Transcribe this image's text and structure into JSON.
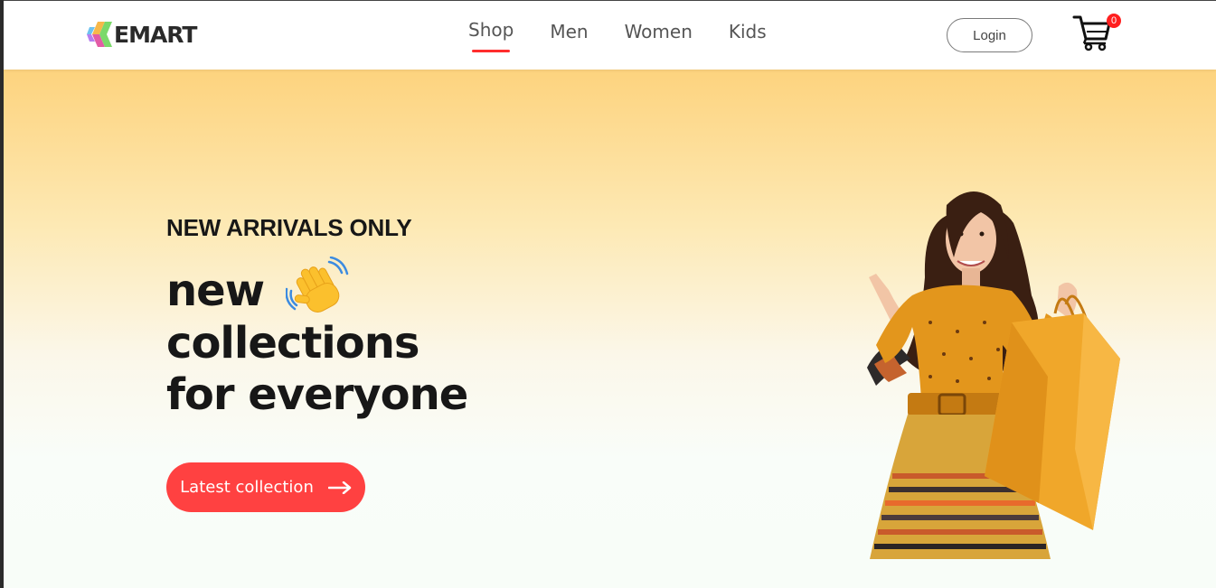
{
  "brand": {
    "name": "EMART",
    "logo_icon": "hexagon-logo-icon"
  },
  "nav": {
    "items": [
      {
        "label": "Shop",
        "active": true
      },
      {
        "label": "Men",
        "active": false
      },
      {
        "label": "Women",
        "active": false
      },
      {
        "label": "Kids",
        "active": false
      }
    ],
    "login_label": "Login",
    "cart": {
      "icon": "cart-icon",
      "count": "0"
    }
  },
  "hero": {
    "tagline": "NEW ARRIVALS ONLY",
    "title_lines": [
      "new",
      "collections",
      "for everyone"
    ],
    "title_emoji": "waving-hand-icon",
    "cta_label": "Latest collection",
    "cta_icon": "arrow-right-icon",
    "image": "woman-with-shopping-bag"
  },
  "colors": {
    "accent": "#ff4141",
    "underline": "#ff2d2d",
    "hero_top": "#fdd37e",
    "hero_bottom": "#f8fdf8"
  }
}
